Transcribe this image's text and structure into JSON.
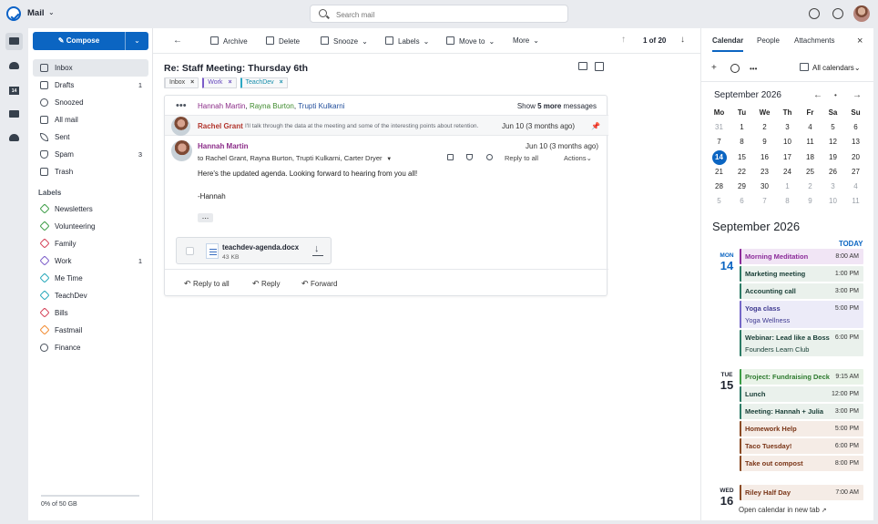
{
  "app": {
    "name": "Mail",
    "search_placeholder": "Search mail"
  },
  "toolbar": {
    "archive": "Archive",
    "delete": "Delete",
    "snooze": "Snooze",
    "labels": "Labels",
    "move_to": "Move to",
    "more": "More",
    "pager": "1 of 20",
    "chev": "⌄"
  },
  "sidebar": {
    "compose": "Compose",
    "chev": "⌄",
    "nav": [
      {
        "label": "Inbox",
        "count": ""
      },
      {
        "label": "Drafts",
        "count": "1"
      },
      {
        "label": "Snoozed",
        "count": ""
      },
      {
        "label": "All mail",
        "count": ""
      },
      {
        "label": "Sent",
        "count": ""
      },
      {
        "label": "Spam",
        "count": "3"
      },
      {
        "label": "Trash",
        "count": ""
      }
    ],
    "labels_heading": "Labels",
    "labels": [
      {
        "label": "Newsletters",
        "count": "",
        "color": "#3b9c45"
      },
      {
        "label": "Volunteering",
        "count": "",
        "color": "#3b9c45"
      },
      {
        "label": "Family",
        "count": "",
        "color": "#d43f55"
      },
      {
        "label": "Work",
        "count": "1",
        "color": "#7b5cc9"
      },
      {
        "label": "Me Time",
        "count": "",
        "color": "#25a7b9"
      },
      {
        "label": "TeachDev",
        "count": "",
        "color": "#25a7b9"
      },
      {
        "label": "Bills",
        "count": "",
        "color": "#d43f55"
      },
      {
        "label": "Fastmail",
        "count": "",
        "color": "#f28a2f"
      },
      {
        "label": "Finance",
        "count": "",
        "color": "#444444"
      }
    ],
    "storage": "0% of 50 GB"
  },
  "message": {
    "subject": "Re: Staff Meeting: Thursday 6th",
    "chips": [
      {
        "label": "Inbox",
        "close": "×"
      },
      {
        "label": "Work",
        "close": "×"
      },
      {
        "label": "TeachDev",
        "close": "×"
      }
    ],
    "thread": {
      "participant_1": "Hannah Martin",
      "participant_2": "Rayna Burton",
      "participant_3": "Trupti Kulkarni",
      "separator": ",",
      "show_more_prefix": "Show ",
      "show_more_count": "5 more",
      "show_more_suffix": " messages",
      "collapsed_sender": "Rachel Grant",
      "collapsed_snippet": "I'll talk through the data at the meeting and some of the interesting points about retention.",
      "collapsed_date": "Jun 10 (3 months ago)",
      "pin": "📌",
      "from": "Hannah Martin",
      "to": "to Rachel Grant, Rayna Burton, Trupti Kulkarni, Carter Dryer",
      "date": "Jun 10 (3 months ago)",
      "reply_to_all": "Reply to all",
      "actions": "Actions",
      "chev": "⌄",
      "dots": "•••",
      "body": "Here's the updated agenda. Looking forward to hearing from you all!",
      "signature": "-Hannah",
      "quoted": "...",
      "attachment_name": "teachdev-agenda.docx",
      "attachment_size": "43 KB",
      "reply_buttons": [
        "Reply to all",
        "Reply",
        "Forward"
      ]
    }
  },
  "calendar": {
    "tabs": [
      "Calendar",
      "People",
      "Attachments"
    ],
    "close": "×",
    "plus": "+",
    "dots": "•••",
    "all_calendars": "All calendars",
    "chev": "⌄",
    "month": "September 2026",
    "mini_nav": [
      "←",
      "•",
      "→"
    ],
    "days": [
      "Mo",
      "Tu",
      "We",
      "Th",
      "Fr",
      "Sa",
      "Su"
    ],
    "dates": [
      "31",
      "1",
      "2",
      "3",
      "4",
      "5",
      "6",
      "7",
      "8",
      "9",
      "10",
      "11",
      "12",
      "13",
      "14",
      "15",
      "16",
      "17",
      "18",
      "19",
      "20",
      "21",
      "22",
      "23",
      "24",
      "25",
      "26",
      "27",
      "28",
      "29",
      "30",
      "1",
      "2",
      "3",
      "4",
      "5",
      "6",
      "7",
      "8",
      "9",
      "10",
      "11"
    ],
    "muted_indexes": [
      0,
      31,
      32,
      33,
      34,
      35,
      36,
      37,
      38,
      39,
      40,
      41
    ],
    "today_index": 14,
    "agenda_month": "September 2026",
    "today_label": "TODAY",
    "groups": [
      {
        "day": "MON",
        "date": "14"
      },
      {
        "day": "TUE",
        "date": "15"
      },
      {
        "day": "WED",
        "date": "16"
      }
    ],
    "events": [
      {
        "title": "Morning Meditation",
        "time": "8:00 AM",
        "sub": "",
        "color": "#8c2c9a",
        "bg": "#f1e5f5"
      },
      {
        "title": "Marketing meeting",
        "time": "1:00 PM",
        "sub": "",
        "color": "#2c7b65",
        "bg": "#eaf1ec"
      },
      {
        "title": "Accounting call",
        "time": "3:00 PM",
        "sub": "",
        "color": "#2c7b65",
        "bg": "#eaf1ec"
      },
      {
        "title": "Yoga class",
        "time": "5:00 PM",
        "sub": "Yoga Wellness",
        "color": "#7467c7",
        "bg": "#ecebf8"
      },
      {
        "title": "Webinar: Lead like a Boss",
        "time": "6:00 PM",
        "sub": "Founders Learn Club",
        "color": "#2c7b65",
        "bg": "#eaf1ec"
      },
      {
        "title": "Project: Fundraising Deck",
        "time": "9:15 AM",
        "sub": "",
        "color": "#3b9c45",
        "bg": "#e9f3e8"
      },
      {
        "title": "Lunch",
        "time": "12:00 PM",
        "sub": "",
        "color": "#2c7b65",
        "bg": "#eaf1ec"
      },
      {
        "title": "Meeting: Hannah + Julia",
        "time": "3:00 PM",
        "sub": "",
        "color": "#2c7b65",
        "bg": "#eaf1ec"
      },
      {
        "title": "Homework Help",
        "time": "5:00 PM",
        "sub": "",
        "color": "#8a4a24",
        "bg": "#f5ece6"
      },
      {
        "title": "Taco Tuesday!",
        "time": "6:00 PM",
        "sub": "",
        "color": "#8a4a24",
        "bg": "#f5ece6"
      },
      {
        "title": "Take out compost",
        "time": "8:00 PM",
        "sub": "",
        "color": "#8a4a24",
        "bg": "#f5ece6"
      },
      {
        "title": "Riley Half Day",
        "time": "7:00 AM",
        "sub": "",
        "color": "#8a4a24",
        "bg": "#f5ece6"
      }
    ],
    "open_new_tab": "Open calendar in new tab"
  }
}
